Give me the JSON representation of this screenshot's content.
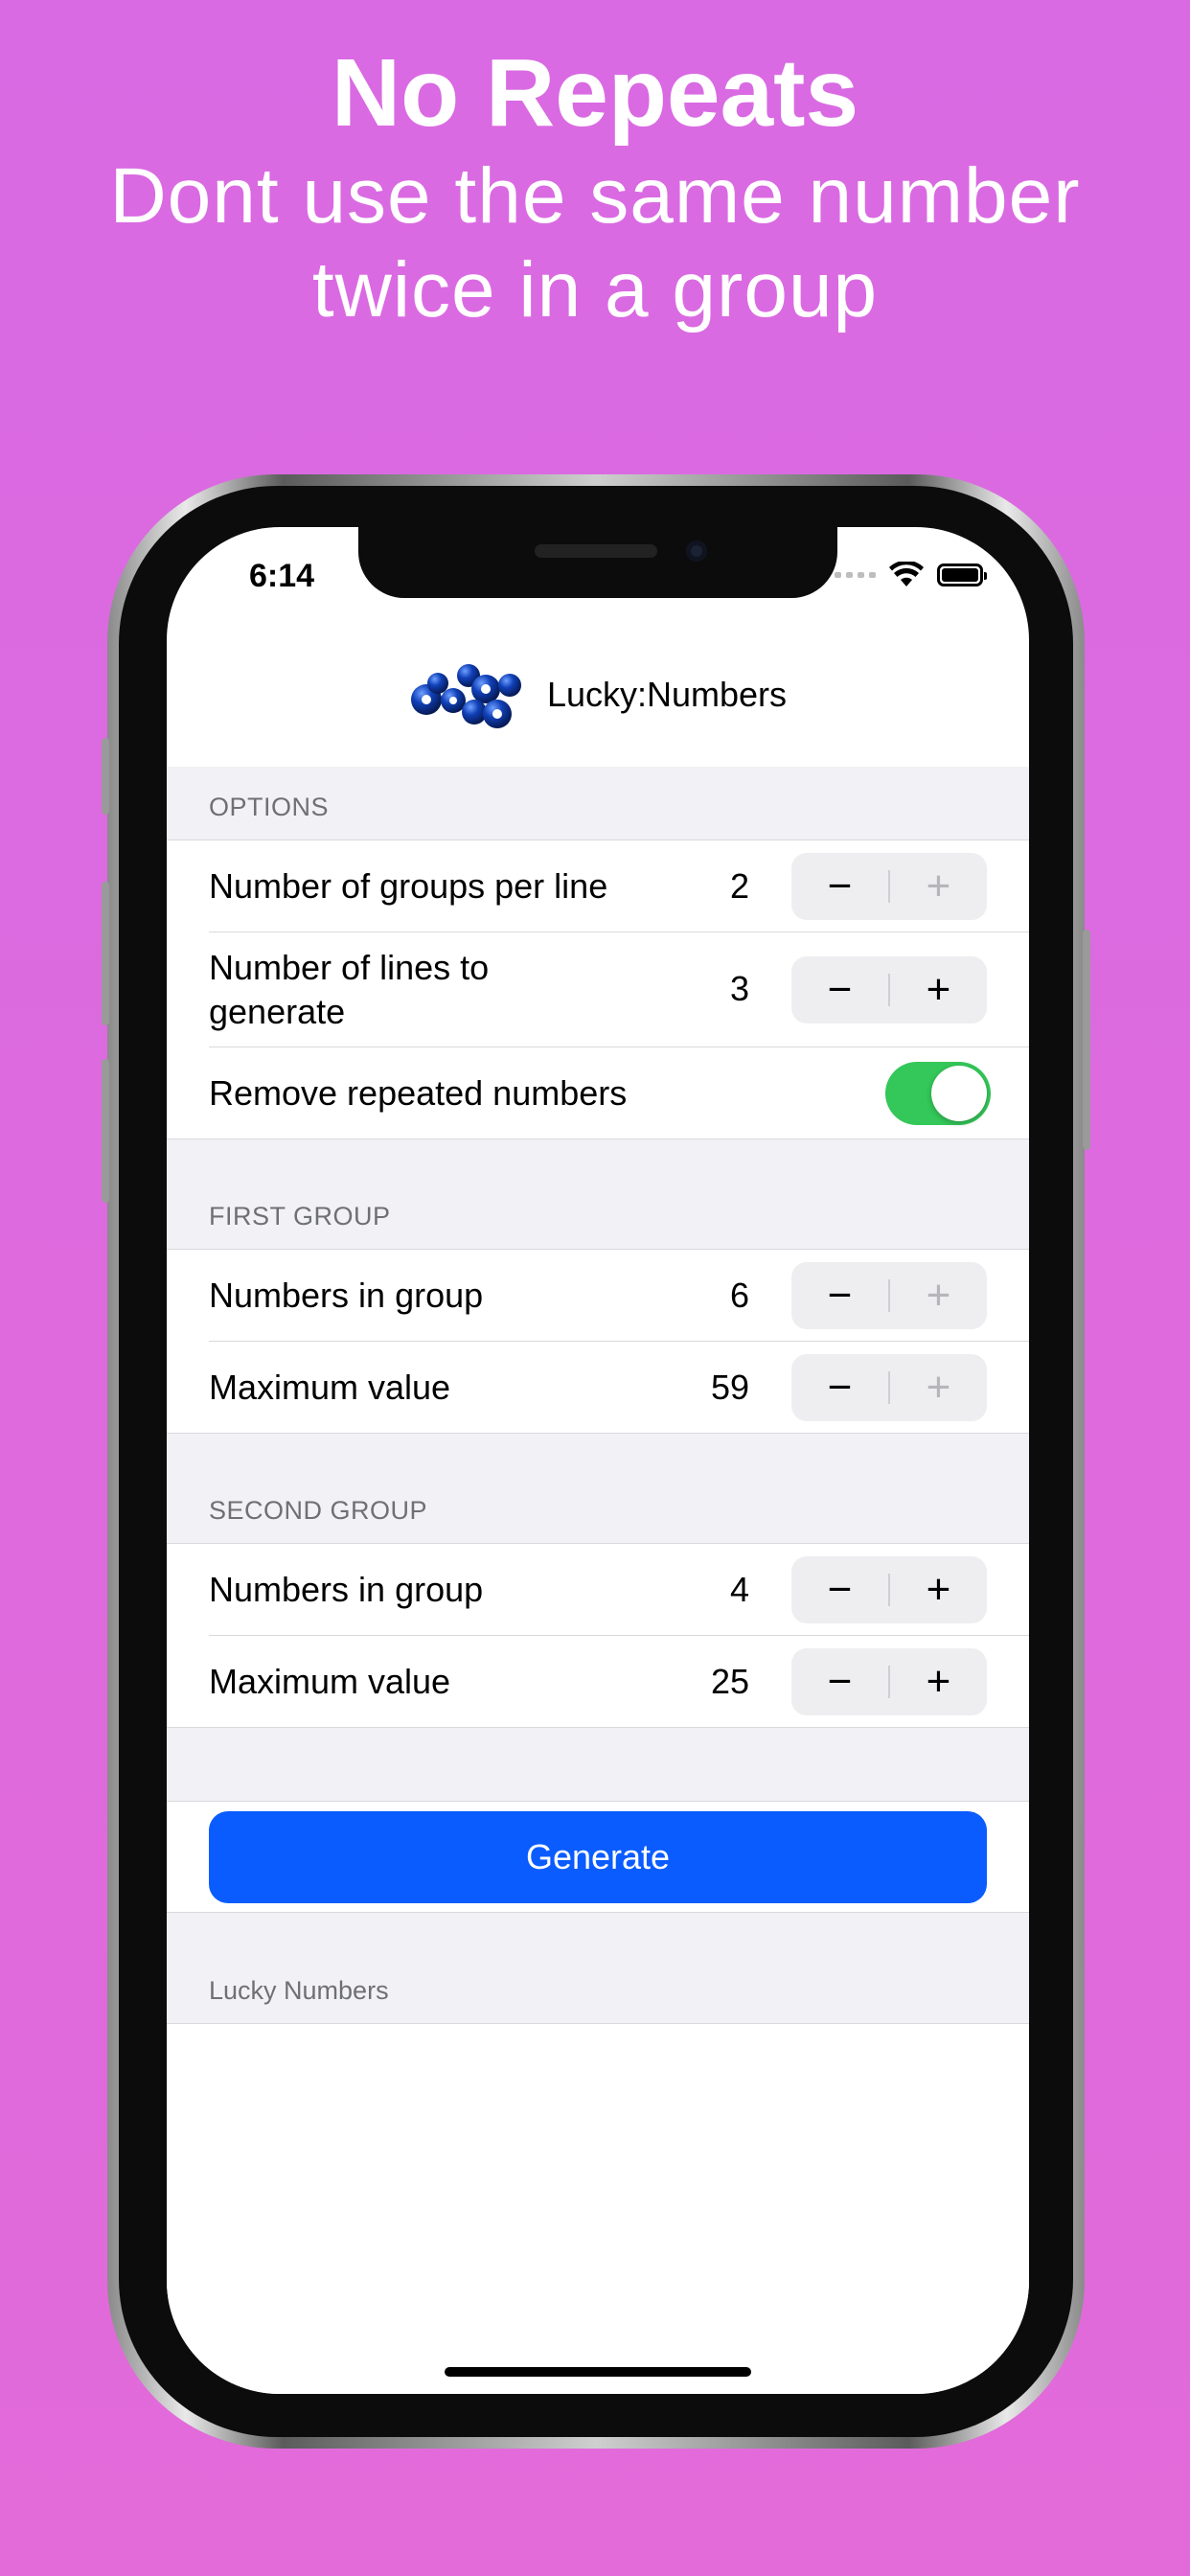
{
  "headline": {
    "title": "No Repeats",
    "subtitle_line1": "Dont use the same number",
    "subtitle_line2": "twice in a group"
  },
  "status_bar": {
    "time": "6:14"
  },
  "nav": {
    "title": "Lucky:Numbers",
    "logo_icon": "lottery-balls-icon"
  },
  "options": {
    "header": "OPTIONS",
    "groups_per_line": {
      "label": "Number of groups per line",
      "value": "2",
      "minus_enabled": true,
      "plus_enabled": false
    },
    "lines_to_generate": {
      "label_line1": "Number of lines to",
      "label_line2": "generate",
      "value": "3",
      "minus_enabled": true,
      "plus_enabled": true
    },
    "remove_repeated": {
      "label": "Remove repeated numbers",
      "on": true
    }
  },
  "first_group": {
    "header": "FIRST GROUP",
    "numbers_in_group": {
      "label": "Numbers in group",
      "value": "6",
      "plus_enabled": false
    },
    "maximum_value": {
      "label": "Maximum value",
      "value": "59",
      "plus_enabled": false
    }
  },
  "second_group": {
    "header": "SECOND GROUP",
    "numbers_in_group": {
      "label": "Numbers in group",
      "value": "4",
      "plus_enabled": true
    },
    "maximum_value": {
      "label": "Maximum value",
      "value": "25",
      "plus_enabled": true
    }
  },
  "generate": {
    "label": "Generate"
  },
  "results": {
    "header": "Lucky Numbers"
  },
  "symbols": {
    "minus": "−",
    "plus": "+"
  },
  "colors": {
    "background": "#e06ad9",
    "accent": "#0a5cff",
    "toggle_on": "#34c759"
  }
}
